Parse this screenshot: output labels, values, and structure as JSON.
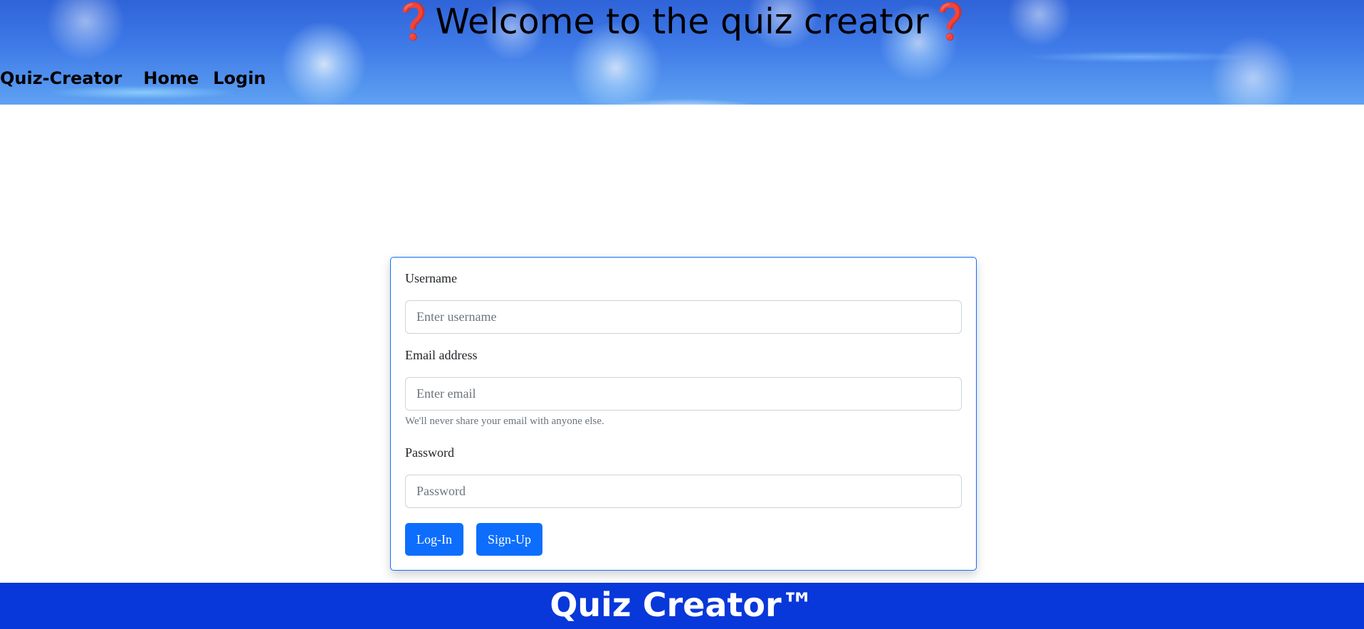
{
  "header": {
    "title_prefix": "❓",
    "title": "Welcome to the quiz creator",
    "title_suffix": "❓"
  },
  "nav": {
    "brand": "Quiz-Creator",
    "links": [
      "Home",
      "Login"
    ]
  },
  "form": {
    "username": {
      "label": "Username",
      "placeholder": "Enter username",
      "value": ""
    },
    "email": {
      "label": "Email address",
      "placeholder": "Enter email",
      "value": "",
      "help": "We'll never share your email with anyone else."
    },
    "password": {
      "label": "Password",
      "placeholder": "Password",
      "value": ""
    },
    "buttons": {
      "login": "Log-In",
      "signup": "Sign-Up"
    }
  },
  "footer": {
    "text": "Quiz Creator™"
  },
  "colors": {
    "primary": "#0d6efd",
    "footer_bg": "#0838da",
    "header_accent": "#2f63d8",
    "question_mark": "#e0301e"
  }
}
